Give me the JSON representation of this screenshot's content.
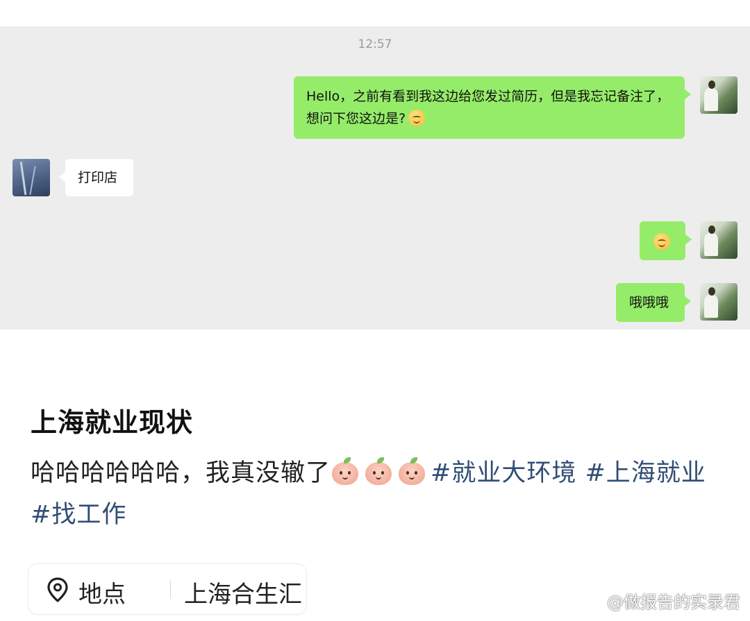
{
  "chat": {
    "timestamp": "12:57",
    "messages": [
      {
        "sender": "me",
        "text": "Hello，之前有看到我这边给您发过简历，但是我忘记备注了，想问下您这边是?",
        "emoji": "smiling-blush-emoji"
      },
      {
        "sender": "other",
        "text": "打印店"
      },
      {
        "sender": "me",
        "text": "",
        "emoji": "smiling-emoji"
      },
      {
        "sender": "me",
        "text": "哦哦哦"
      }
    ]
  },
  "post": {
    "title": "上海就业现状",
    "body_text": "哈哈哈哈哈哈，我真没辙了",
    "reaction_emoji": "peach-emoji",
    "tags": [
      "#就业大环境",
      "#上海就业",
      "#找工作"
    ]
  },
  "location": {
    "label": "地点",
    "value": "上海合生汇"
  },
  "watermark": {
    "text": "@做报告的实录君"
  },
  "colors": {
    "chat_background": "#ededed",
    "my_bubble": "#95ec69",
    "other_bubble": "#ffffff",
    "tag_link": "#304d74"
  }
}
